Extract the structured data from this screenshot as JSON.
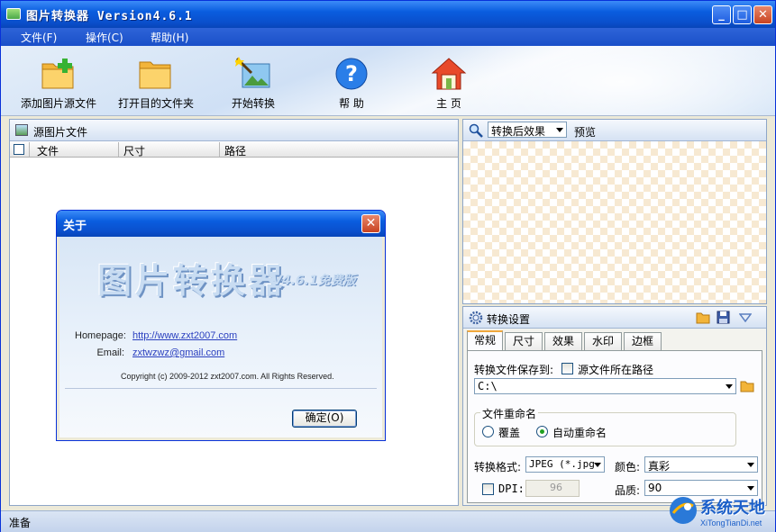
{
  "window": {
    "title": "图片转换器 Version4.6.1",
    "controls": [
      "_",
      "□",
      "✕"
    ]
  },
  "menu": [
    {
      "label": "文件(F)"
    },
    {
      "label": "操作(C)"
    },
    {
      "label": "帮助(H)"
    }
  ],
  "toolbar": [
    {
      "label": "添加图片源文件",
      "icon": "add-folder-icon"
    },
    {
      "label": "打开目的文件夹",
      "icon": "folder-icon"
    },
    {
      "label": "开始转换",
      "icon": "magic-wand-icon"
    },
    {
      "label": "帮 助",
      "icon": "help-icon"
    },
    {
      "label": "主 页",
      "icon": "home-icon"
    }
  ],
  "source_panel": {
    "title": "源图片文件",
    "columns": [
      "文件",
      "尺寸",
      "路径"
    ]
  },
  "preview_panel": {
    "mode_select": "转换后效果",
    "label": "预览"
  },
  "settings_panel": {
    "title": "转换设置",
    "tabs": [
      "常规",
      "尺寸",
      "效果",
      "水印",
      "边框"
    ],
    "active_tab": "常规",
    "save_to_label": "转换文件保存到:",
    "source_path_checkbox": "源文件所在路径",
    "save_path": "C:\\",
    "rename_group": "文件重命名",
    "rename_options": [
      "覆盖",
      "自动重命名"
    ],
    "rename_selected": "自动重命名",
    "format_label": "转换格式:",
    "format_value": "JPEG (*.jpg",
    "color_label": "颜色:",
    "color_value": "真彩",
    "dpi_label": "DPI:",
    "dpi_value": "96",
    "quality_label": "品质:",
    "quality_value": "90"
  },
  "status": {
    "text": "准备"
  },
  "about_dialog": {
    "title": "关于",
    "logo": "图片转换器",
    "version_badge": "V4.6.1免费版",
    "homepage_label": "Homepage:",
    "homepage_url": "http://www.zxt2007.com",
    "email_label": "Email:",
    "email": "zxtwzwz@gmail.com",
    "copyright": "Copyright (c) 2009-2012 zxt2007.com. All Rights Reserved.",
    "ok_label": "确定(O)"
  },
  "watermark": {
    "text": "系统天地",
    "url": "XiTongTianDi.net"
  },
  "colors": {
    "titlebar": "#0a5ddf",
    "menubar": "#2e64d8",
    "panel_border": "#8ea6c8",
    "checker": "#f7e9d2",
    "link": "#2a3fbf"
  }
}
